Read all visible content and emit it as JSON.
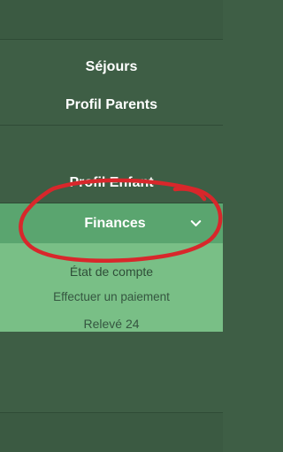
{
  "menu": {
    "items": [
      {
        "label": "Séjours"
      },
      {
        "label": "Profil Parents"
      },
      {
        "label": "Profil Enfant"
      },
      {
        "label": "Finances"
      }
    ]
  },
  "submenu": {
    "items": [
      {
        "label": "État de compte"
      },
      {
        "label": "Effectuer un paiement"
      },
      {
        "label": "Relevé 24"
      }
    ]
  },
  "colors": {
    "nav_dark": "#3e5e45",
    "finances_active": "#5aa56f",
    "submenu_bg": "#79bf86",
    "annotation_red": "#d8272b"
  },
  "icons": {
    "expand": "chevron-down-icon"
  }
}
